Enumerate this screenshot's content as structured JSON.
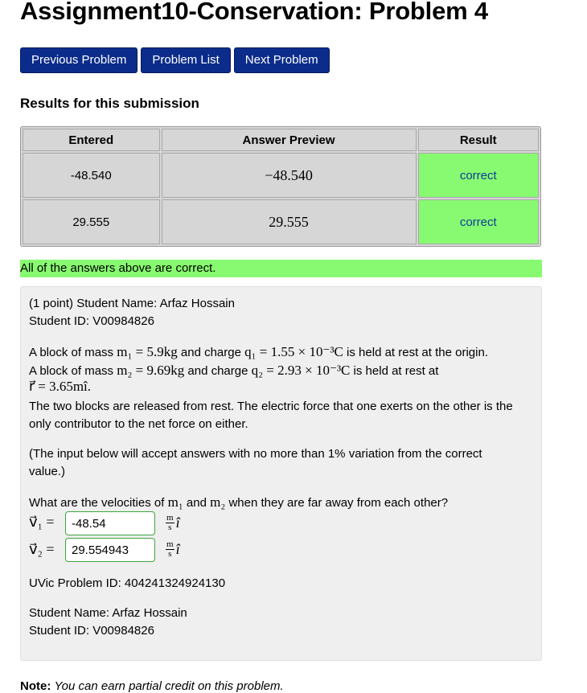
{
  "page": {
    "title": "Assignment10-Conservation: Problem 4"
  },
  "nav": {
    "previous": "Previous Problem",
    "list": "Problem List",
    "next": "Next Problem"
  },
  "results": {
    "heading": "Results for this submission",
    "columns": [
      "Entered",
      "Answer Preview",
      "Result"
    ],
    "rows": [
      {
        "entered": "-48.540",
        "preview": "−48.540",
        "result": "correct"
      },
      {
        "entered": "29.555",
        "preview": "29.555",
        "result": "correct"
      }
    ],
    "summary": "All of the answers above are correct.",
    "correct_color": "#88fa71"
  },
  "problem": {
    "points_line": "(1 point) Student Name: Arfaz Hossain",
    "id_line": "Student ID: V00984826",
    "text1a": "A block of mass ",
    "m1_expr": "m₁ = 5.9kg",
    "text1b": " and charge ",
    "q1_expr": "q₁ = 1.55 × 10⁻³C",
    "text1c": " is held at rest at the origin.",
    "text2a": "A block of mass ",
    "m2_expr": "m₂ = 9.69kg",
    "text2b": " and charge ",
    "q2_expr": "q₂ = 2.93 × 10⁻³C",
    "text2c": " is held at rest at",
    "r_expr": "r⃗ = 3.65mî.",
    "text3": "The two blocks are released from rest. The electric force that one exerts on the other is the",
    "text4": "only contributor to the net force on either.",
    "note1": "(The input below will accept answers with no more than 1% variation from the correct",
    "note2": "value.)",
    "question_a": "What are the velocities of ",
    "question_m1": "m₁",
    "question_b": " and ",
    "question_m2": "m₂",
    "question_c": " when they are far away from each other?",
    "v1_label": "v⃗₁ =",
    "v1_value": "-48.54",
    "v2_label": "v⃗₂ =",
    "v2_value": "29.554943",
    "unit_num": "m",
    "unit_den": "s",
    "unit_dir": "î",
    "uvic_id": "UVic Problem ID: 404241324924130",
    "footer_name": "Student Name: Arfaz Hossain",
    "footer_id": "Student ID: V00984826"
  },
  "footnote": {
    "label": "Note:",
    "text": "You can earn partial credit on this problem."
  }
}
